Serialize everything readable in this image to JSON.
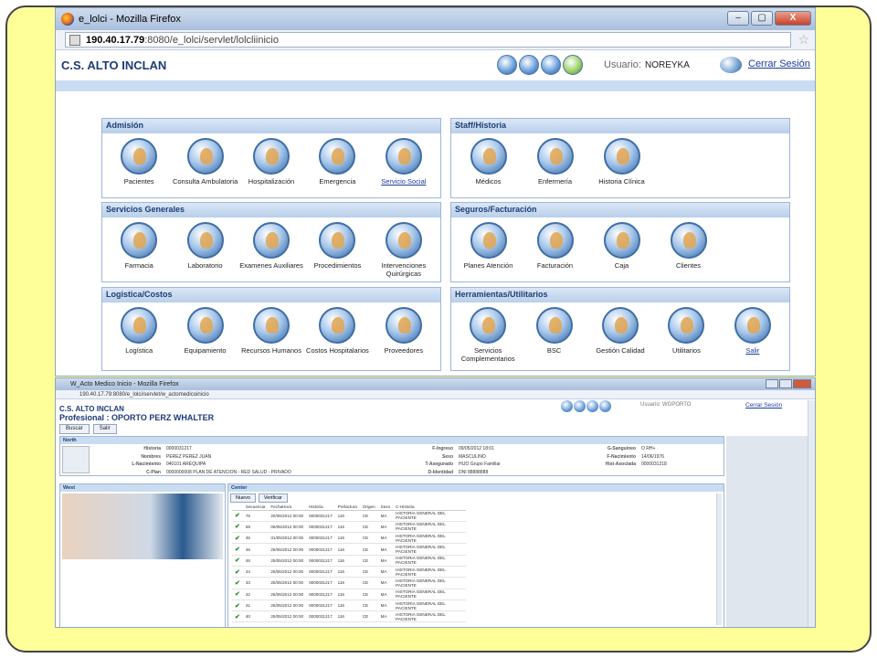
{
  "window1": {
    "title": "e_lolci - Mozilla Firefox",
    "url_host": "190.40.17.79",
    "url_rest": ":8080/e_lolci/servlet/lolcliinicio",
    "controls": {
      "minimize": "–",
      "maximize": "▢",
      "close": "X"
    },
    "app_title": "C.S. ALTO INCLAN",
    "usuario_label": "Usuario:",
    "usuario_value": "NOREYKA",
    "logout": "Cerrar Sesión",
    "panels": [
      {
        "title": "Admisión",
        "items": [
          "Pacientes",
          "Consulta Ambulatoria",
          "Hospitalización",
          "Emergencia",
          "Servicio Social"
        ]
      },
      {
        "title": "Staff/Historia",
        "items": [
          "Médicos",
          "Enfermería",
          "Historia Clínica"
        ]
      },
      {
        "title": "Servicios Generales",
        "items": [
          "Farmacia",
          "Laboratorio",
          "Examenes Auxiliares",
          "Procedimientos",
          "Intervenciones Quirúrgicas"
        ]
      },
      {
        "title": "Seguros/Facturación",
        "items": [
          "Planes Atención",
          "Facturación",
          "Caja",
          "Clientes"
        ]
      },
      {
        "title": "Logistica/Costos",
        "items": [
          "Logística",
          "Equipamiento",
          "Recursos Humanos",
          "Costos Hospitalarios",
          "Proveedores"
        ]
      },
      {
        "title": "Herramientas/Utilitarios",
        "items": [
          "Servicios Complementarios",
          "BSC",
          "Gestión Calidad",
          "Utilitarios",
          "Salir"
        ]
      }
    ]
  },
  "window2": {
    "title": "W_Acto Medico Inicio - Mozilla Firefox",
    "url": "190.40.17.79:8080/e_lolci/servlet/w_actomedicoinicio",
    "app_title": "C.S. ALTO INCLAN",
    "usuario": "Usuario: WOPORTO",
    "logout": "Cerrar Sesión",
    "profesional": "Profesional : OPORTO PERZ WHALTER",
    "btn_buscar": "Buscar",
    "btn_salir": "Salir",
    "north_title": "North",
    "west_title": "West",
    "center_title": "Center",
    "fields_left": [
      {
        "k": "Historia",
        "v": "0000031217"
      },
      {
        "k": "Nombres",
        "v": "PEREZ PEREZ JUAN"
      },
      {
        "k": "L-Nacimiento",
        "v": "040101   AREQUIPA"
      },
      {
        "k": "C-Plan",
        "v": "0000000008   PLAN DE ATENCION - RED SALUD - PRIVADO"
      }
    ],
    "fields_mid": [
      {
        "k": "F-Ingreso",
        "v": "09/05/2012 18:01"
      },
      {
        "k": "Sexo",
        "v": "MASCULINO"
      },
      {
        "k": "T-Asegurado",
        "v": "HIJO   Grupo Familiar"
      },
      {
        "k": "D-Identidad",
        "v": "DNI   88888888"
      }
    ],
    "fields_right": [
      {
        "k": "G-Sanguineo",
        "v": "O RH+"
      },
      {
        "k": "F-Nacimiento",
        "v": "14/06/1976"
      },
      {
        "k": "Hist-Asociada",
        "v": "0000031218"
      }
    ],
    "btn_nuevo": "Nuevo",
    "btn_verificar": "Verificar",
    "grid_headers": [
      "",
      "Secuencia",
      "FechaHora",
      "Historia",
      "Prefactura",
      "Origen",
      "Sexo",
      "C-Historia"
    ],
    "grid_rows": [
      [
        "76",
        "20/06/2012 00:00",
        "0000031217",
        "116",
        "CE",
        "MA",
        "HISTORIA GENERAL DEL PACIENTE"
      ],
      [
        "59",
        "06/06/2012 00:00",
        "0000031217",
        "116",
        "CE",
        "MA",
        "HISTORIA GENERAL DEL PACIENTE"
      ],
      [
        "45",
        "31/05/2012 00:00",
        "0000031217",
        "116",
        "CE",
        "MA",
        "HISTORIA GENERAL DEL PACIENTE"
      ],
      [
        "46",
        "25/05/2012 00:00",
        "0000031217",
        "116",
        "CE",
        "MA",
        "HISTORIA GENERAL DEL PACIENTE"
      ],
      [
        "46",
        "25/05/2012 00:00",
        "0000031217",
        "116",
        "CE",
        "MA",
        "HISTORIA GENERAL DEL PACIENTE"
      ],
      [
        "44",
        "25/05/2012 00:00",
        "0000031217",
        "116",
        "CE",
        "MA",
        "HISTORIA GENERAL DEL PACIENTE"
      ],
      [
        "43",
        "25/05/2012 00:00",
        "0000031217",
        "116",
        "CE",
        "MA",
        "HISTORIA GENERAL DEL PACIENTE"
      ],
      [
        "42",
        "25/05/2012 00:00",
        "0000031217",
        "116",
        "CE",
        "MA",
        "HISTORIA GENERAL DEL PACIENTE"
      ],
      [
        "41",
        "25/05/2012 00:00",
        "0000031217",
        "116",
        "CE",
        "MA",
        "HISTORIA GENERAL DEL PACIENTE"
      ],
      [
        "40",
        "25/05/2012 00:00",
        "0000031217",
        "116",
        "CE",
        "MA",
        "HISTORIA GENERAL DEL PACIENTE"
      ]
    ]
  },
  "colors": {
    "slide_bg": "#ffff99",
    "header_blue": "#1d3b78",
    "link": "#1d3b9c"
  }
}
